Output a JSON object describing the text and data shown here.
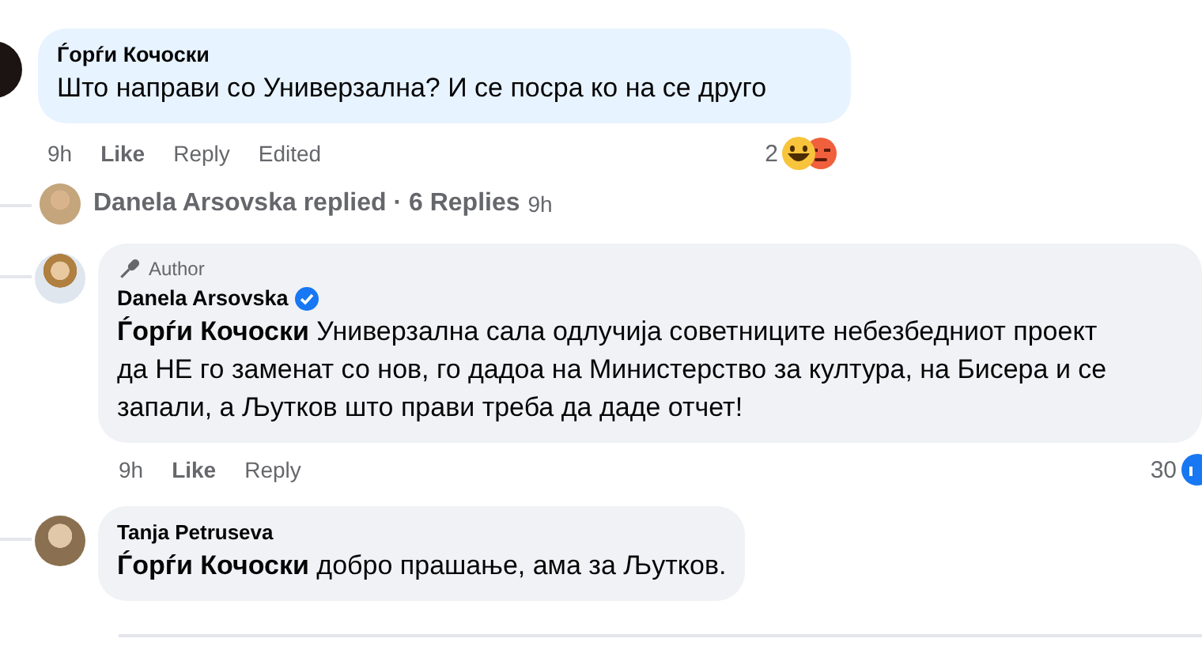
{
  "comment": {
    "author": "Ѓорѓи Кочоски",
    "text": "Што направи со Универзална? И се посра ко на се друго",
    "actions": [
      {
        "kind": "time",
        "label": "9h"
      },
      {
        "kind": "link",
        "label": "Like"
      },
      {
        "kind": "plain",
        "label": "Reply"
      },
      {
        "kind": "plain",
        "label": "Edited"
      }
    ],
    "reaction_count": "2"
  },
  "replies_summary": {
    "text": "Danela Arsovska replied · 6 Replies",
    "time": "9h"
  },
  "replies": [
    {
      "badge": "Author",
      "author": "Danela Arsovska",
      "verified": true,
      "mention": "Ѓорѓи Кочоски",
      "text": "Универзална сала одлучија советниците небезбедниот проект да НЕ го заменат со нов, го дадоа на Министерство за култура, на Бисера и се запали, а Љутков што прави треба да даде отчет!",
      "actions": [
        {
          "kind": "time",
          "label": "9h"
        },
        {
          "kind": "link",
          "label": "Like"
        },
        {
          "kind": "plain",
          "label": "Reply"
        }
      ],
      "reaction_count": "30"
    },
    {
      "author": "Tanja Petruseva",
      "verified": false,
      "mention": "Ѓорѓи Кочоски",
      "text": "добро прашање, ама за Љутков."
    }
  ]
}
